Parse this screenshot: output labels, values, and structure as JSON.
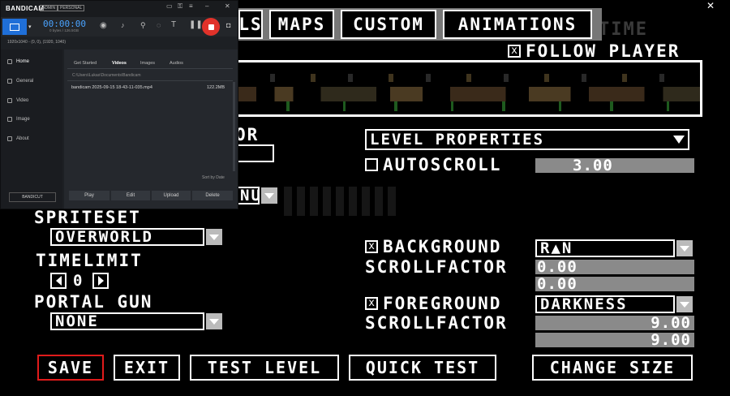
{
  "editor": {
    "tabs": [
      "LS",
      "MAPS",
      "CUSTOM",
      "ANIMATIONS"
    ],
    "follow_player_label": "FOLLOW PLAYER",
    "follow_player_checked": "x",
    "level_properties_select": "LEVEL PROPERTIES",
    "autoscroll_label": "AUTOSCROLL",
    "autoscroll_value": "3.00",
    "partial_left_label": "OR",
    "partial_menu_label": "NU",
    "spriteset_label": "SPRITESET",
    "spriteset_value": "OVERWORLD",
    "timelimit_label": "TIMELIMIT",
    "timelimit_value": "0",
    "portal_gun_label": "PORTAL GUN",
    "portal_gun_value": "NONE",
    "background_label": "BACKGROUND",
    "background_checked": "x",
    "background_value": "R▲N",
    "bg_scroll_label": "SCROLLFACTOR",
    "bg_scroll_x": "0.00",
    "bg_scroll_y": "0.00",
    "foreground_label": "FOREGROUND",
    "foreground_checked": "x",
    "foreground_value": "DARKNESS",
    "fg_scroll_label": "SCROLLFACTOR",
    "fg_scroll_x": "9.00",
    "fg_scroll_y": "9.00",
    "buttons": {
      "save": "SAVE",
      "exit": "EXIT",
      "test_level": "TEST LEVEL",
      "quick_test": "QUICK TEST",
      "change_size": "CHANGE SIZE"
    },
    "bg_text_time": "TIME"
  },
  "bandicam": {
    "logo": "BANDICAM",
    "badge_admin": "ADMIN",
    "badge_personal": "PERSONAL",
    "timer": "00:00:00",
    "size_info": "0 bytes / 126.5GB",
    "resolution": "1920x1040 - (0, 0), (1920, 1040)",
    "sidebar": [
      "Home",
      "General",
      "Video",
      "Image",
      "About"
    ],
    "tabs": [
      "Get Started",
      "Videos",
      "Images",
      "Audios"
    ],
    "path": "C:\\Users\\Lukas\\Documents\\Bandicam",
    "file_name": "bandicam 2025-09-15 18-43-11-035.mp4",
    "file_size": "122.2MB",
    "sort_label": "Sort by Date",
    "bandicut": "BANDICUT",
    "actions": [
      "Play",
      "Edit",
      "Upload",
      "Delete"
    ],
    "accent_record": "#e0322a",
    "accent_blue": "#1f6fd8"
  }
}
